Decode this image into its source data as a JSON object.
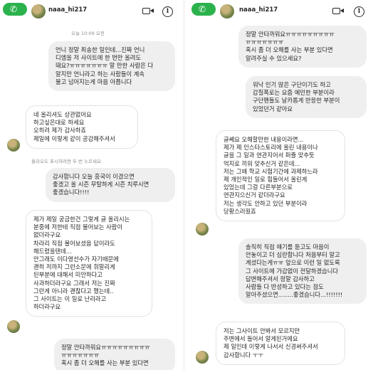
{
  "left": {
    "username": "naaa_hi217",
    "timestamp": "오늘 10:09 오전",
    "system_note": "올라오도 표시하려면 두 번 누르세요",
    "messages": [
      {
        "dir": "out",
        "text": "언니 정말 죄송한 일인데...진짜 언니\n디엠을 저 사이트에 한 번만 올려도\n돼요?ㅠㅠㅠㅠㅠㅠㅠ 말 만한 사람은 다\n알지만 언니라고 하는 사람들이 계속\n물고 넘어지는게 마음 아픕니다"
      },
      {
        "dir": "in",
        "text": "네 올리셔도 상관없어요\n하고싶은대로 하세요\n오히려 제가 감사하죠\n제일에 이렇게 같이 공감해주셔서"
      },
      {
        "dir": "out",
        "text": "감사합니다 오늘 흥국이 이겼으면\n좋겠고 올 시즌 무탈하게 시즌 치루시면\n좋겠습니다!!!!"
      },
      {
        "dir": "in",
        "text": "제가 제일 궁금한건 그렇게 글 올리시는\n분중에 저한테 직접 물어보는 사람이\n없더라구요\n차라리 직접 물어보셨음 답이라도\n해드렸을텐데...\n안그래도 이다영선수가 자기때문에\n괜히 저까지 그런소문에 휘말리게\n된부분에 대해서 미안하다고\n사과하더라구요 그래서 저는 진짜\n그런게 아니라 괜찮다고 했는데..\n그 사이트는 이 일로 난리라고\n하더라구요"
      },
      {
        "dir": "out",
        "text": "정말 안타까워요ㅠㅠㅠㅠㅠㅠㅠㅠㅠ\nㅠㅠㅠㅠㅠㅠㅠ\n혹시 좀 더 오해를 사는 부분 있다면"
      }
    ]
  },
  "right": {
    "username": "naaa_hi217",
    "messages": [
      {
        "dir": "out",
        "text": "정말 안타까워요ㅠㅠㅠㅠㅠㅠㅠㅠㅠ\nㅠㅠㅠㅠㅠㅠㅠ\n혹시 좀 더 오해를 사는 부분 있다면\n알려주실 수 있으세요?"
      },
      {
        "dir": "out",
        "text": "워낙 인기 많은 구단이기도 하고\n갑질폭로는 요즘 예민한 부분이라\n구단팬들도 날카롭게 반응한 부분이\n있었던거 같아요"
      },
      {
        "dir": "in",
        "text": "글쎄요 오해할만한 내용이라면...\n제가 제 인스타스토리에 올린 내용이나\n글을 그 일과 연관지어서 퍼즐 맞추듯\n억지로 끼워 맞추신거 같은데...\n저는 그때 학교 시험기간에 과제하느라\n제 개인적인 일로 힘들어서 올린게\n있었는데 그걸 다른부분으로\n연관지으신거 같더라구요\n저는 생각도 안하고 있던 부분이라\n당황스러웠죠"
      },
      {
        "dir": "out",
        "text": "솔직히 직접 얘기를 듣고도 마음이\n안놓이고 더 심란합니다 처음부터 알고\n계셨다는게ㅠㅠ 앞으로 이런 일 없도록\n그 사이트에 가감없이 전달하겠습니다\n답변해주셔서 정말 감사하고\n사람들 다 반성하고 있다는 점도\n알아주셨으면........좋겠습니다...!!!!!!!"
      },
      {
        "dir": "in",
        "text": "저는 그사이트 안봐서 모르지만\n주변에서 들어서 알게된거에요\n제 일인데 이렇게 나서서 신경써주셔서\n감사합니다 ㅜㅜ"
      }
    ]
  }
}
